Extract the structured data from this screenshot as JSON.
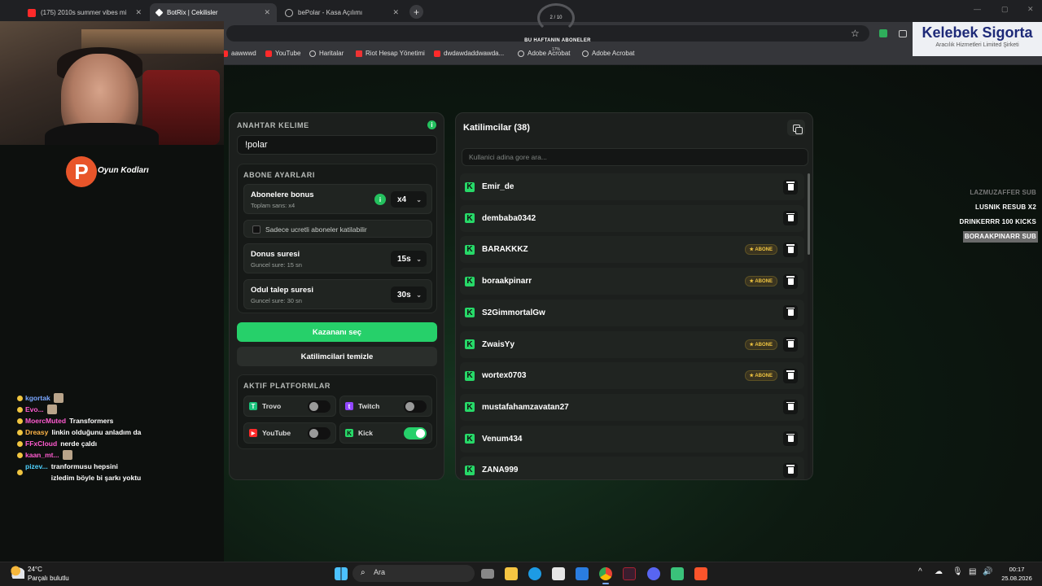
{
  "browser": {
    "tabs": [
      {
        "label": "(175) 2010s summer vibes mi",
        "active": false
      },
      {
        "label": "BotRix | Cekilisler",
        "active": true
      },
      {
        "label": "bePolar - Kasa Açılımı",
        "active": false
      }
    ],
    "bookmarks": [
      "aawwwd",
      "YouTube",
      "Haritalar",
      "Riot Hesap Yönetimi",
      "dwdawdaddwawda...",
      "Adobe Acrobat",
      "Adobe Acrobat"
    ]
  },
  "overlay": {
    "subs_title": "BU HAFTANIN ABONELER",
    "subs_progress": "2 / 10",
    "subs_small": "17%",
    "sponsor_name": "Kelebek Sigorta",
    "sponsor_sub": "Aracılık Hizmetleri Limited Şirketi",
    "brand_text": "Oyun Kodları",
    "brand_letter": "P",
    "alerts": [
      {
        "text": "LAZMUZAFFER SUB",
        "style": "dim"
      },
      {
        "text": "LUSNIK RESUB X2",
        "style": "normal"
      },
      {
        "text": "DRINKERRR 100 KICKS",
        "style": "normal"
      },
      {
        "text": "BORAAKPINARR SUB",
        "style": "highlight"
      }
    ],
    "chat": [
      {
        "user": "kgortak",
        "color": "#7aa7ff",
        "msg": ""
      },
      {
        "user": "Evo...",
        "color": "#ff5bd0",
        "msg": ""
      },
      {
        "user": "MoercMuted",
        "color": "#ff5bd0",
        "msg": "Transformers"
      },
      {
        "user": "Dreasy",
        "color": "#ffb547",
        "msg": "linkin olduğunu anladım da"
      },
      {
        "user": "FFxCloud",
        "color": "#ff5bd0",
        "msg": "nerde çaldı"
      },
      {
        "user": "kaan_mt...",
        "color": "#ff5bd0",
        "msg": ""
      },
      {
        "user": "pizev...",
        "color": "#4fd2ff",
        "msg": "tranformusu hepsini izledim böyle bi şarkı yoktu"
      }
    ]
  },
  "app": {
    "keyword": {
      "label": "ANAHTAR KELIME",
      "value": "!polar",
      "info": "i"
    },
    "subscriber_settings": {
      "label": "ABONE AYARLARI",
      "bonus": {
        "title": "Abonelere bonus",
        "subtitle": "Toplam sans: x4",
        "value": "x4"
      },
      "paid_only": {
        "label": "Sadece ucretli aboneler katilabilir",
        "checked": false
      },
      "loop": {
        "title": "Donus suresi",
        "subtitle": "Guncel sure: 15 sn",
        "value": "15s"
      },
      "claim": {
        "title": "Odul talep suresi",
        "subtitle": "Guncel sure: 30 sn",
        "value": "30s"
      }
    },
    "pick_winner_label": "Kazananı seç",
    "clear_label": "Katilimcilari temizle",
    "platforms": {
      "label": "AKTIF PLATFORMLAR",
      "items": [
        {
          "name": "Trovo",
          "on": false,
          "color": "#19c27b"
        },
        {
          "name": "Twitch",
          "on": false,
          "color": "#9146ff"
        },
        {
          "name": "YouTube",
          "on": false,
          "color": "#ff2a2a"
        },
        {
          "name": "Kick",
          "on": true,
          "color": "#27d968"
        }
      ]
    },
    "participants": {
      "title": "Katilimcilar (38)",
      "search_placeholder": "Kullanici adina gore ara...",
      "badge_label": "ABONE",
      "list": [
        {
          "name": "Emir_de",
          "sub": false
        },
        {
          "name": "dembaba0342",
          "sub": false
        },
        {
          "name": "BARAKKKZ",
          "sub": true
        },
        {
          "name": "boraakpinarr",
          "sub": true
        },
        {
          "name": "S2GimmortalGw",
          "sub": false
        },
        {
          "name": "ZwaisYy",
          "sub": true
        },
        {
          "name": "wortex0703",
          "sub": true
        },
        {
          "name": "mustafahamzavatan27",
          "sub": false
        },
        {
          "name": "Venum434",
          "sub": false
        },
        {
          "name": "ZANA999",
          "sub": false
        }
      ]
    }
  },
  "taskbar": {
    "temp": "24°C",
    "weather": "Parçalı bulutlu",
    "search": "Ara",
    "time": "00:17",
    "date": "25.08.2026"
  }
}
